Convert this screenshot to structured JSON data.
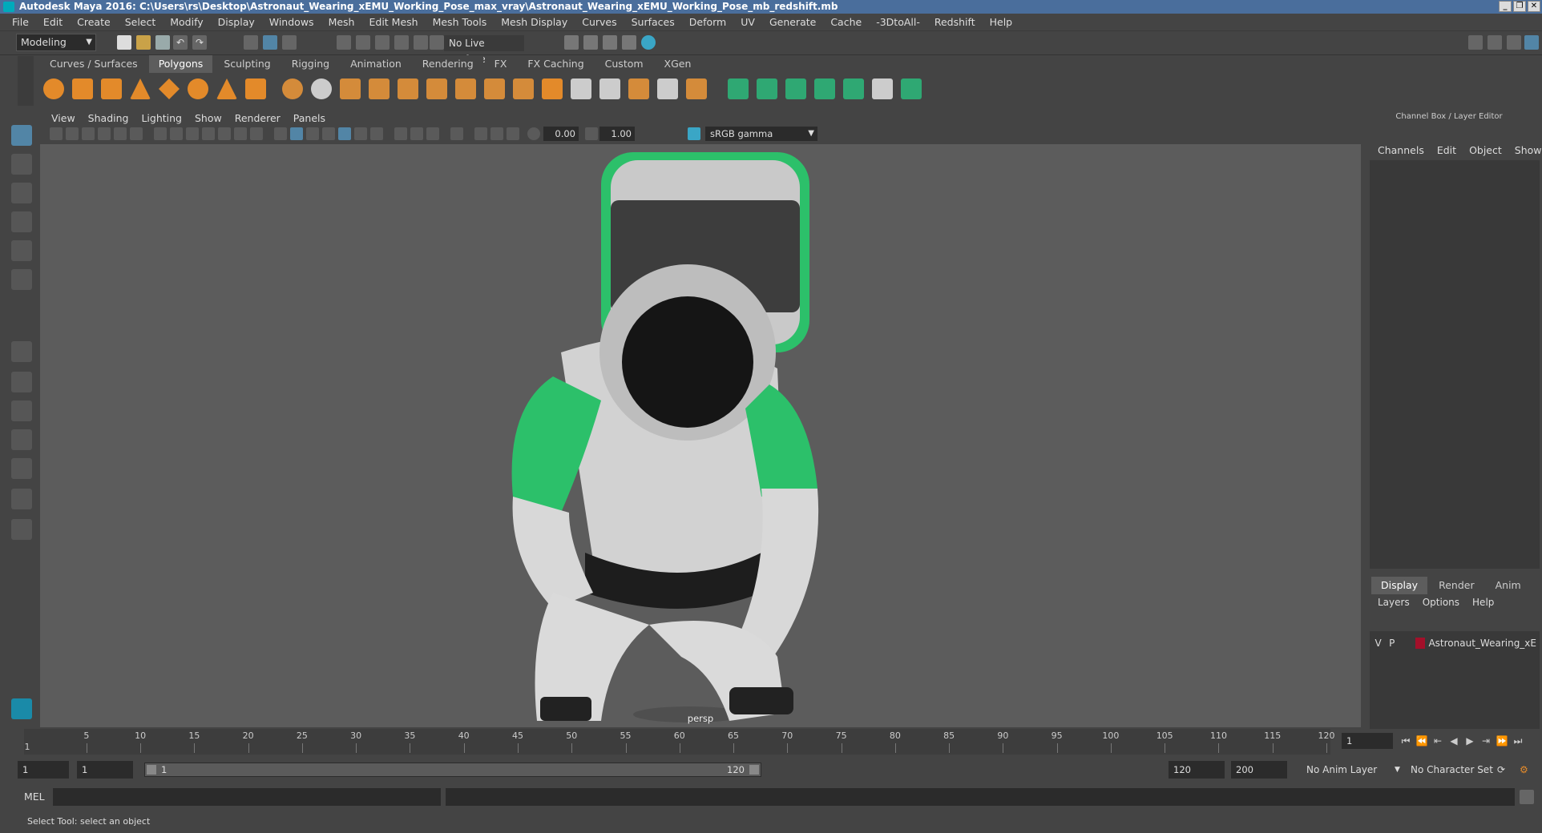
{
  "window": {
    "title": "Autodesk Maya 2016: C:\\Users\\rs\\Desktop\\Astronaut_Wearing_xEMU_Working_Pose_max_vray\\Astronaut_Wearing_xEMU_Working_Pose_mb_redshift.mb",
    "minimize": "_",
    "restore": "❐",
    "close": "✕"
  },
  "menubar": [
    "File",
    "Edit",
    "Create",
    "Select",
    "Modify",
    "Display",
    "Windows",
    "Mesh",
    "Edit Mesh",
    "Mesh Tools",
    "Mesh Display",
    "Curves",
    "Surfaces",
    "Deform",
    "UV",
    "Generate",
    "Cache",
    "-3DtoAll-",
    "Redshift",
    "Help"
  ],
  "statusline": {
    "mode": "Modeling",
    "live_surface": "No Live Surface"
  },
  "shelf": {
    "tabs": [
      "Curves / Surfaces",
      "Polygons",
      "Sculpting",
      "Rigging",
      "Animation",
      "Rendering",
      "FX",
      "FX Caching",
      "Custom",
      "XGen"
    ],
    "active_tab": "Polygons"
  },
  "viewport": {
    "menu": [
      "View",
      "Shading",
      "Lighting",
      "Show",
      "Renderer",
      "Panels"
    ],
    "exposure": "0.00",
    "gamma": "1.00",
    "color_space": "sRGB gamma",
    "camera": "persp"
  },
  "channel_box": {
    "title": "Channel Box / Layer Editor",
    "menu": [
      "Channels",
      "Edit",
      "Object",
      "Show"
    ],
    "tabs": [
      "Display",
      "Render",
      "Anim"
    ],
    "active_tab": "Display",
    "layer_menu": [
      "Layers",
      "Options",
      "Help"
    ],
    "layers": [
      {
        "v": "V",
        "p": "P",
        "name": "Astronaut_Wearing_xE",
        "color": "#a3102a"
      }
    ]
  },
  "timeline": {
    "ticks": [
      "5",
      "10",
      "15",
      "20",
      "25",
      "30",
      "35",
      "40",
      "45",
      "50",
      "55",
      "60",
      "65",
      "70",
      "75",
      "80",
      "85",
      "90",
      "95",
      "100",
      "105",
      "110",
      "115",
      "120"
    ],
    "first_label": "1",
    "current_frame": "1"
  },
  "range": {
    "start_field": "1",
    "playback_start": "1",
    "slider_start": "1",
    "slider_end": "120",
    "playback_end": "120",
    "end_field": "200",
    "anim_layer": "No Anim Layer",
    "character_set": "No Character Set"
  },
  "cmdline": {
    "label": "MEL"
  },
  "helpline": {
    "text": "Select Tool: select an object"
  }
}
